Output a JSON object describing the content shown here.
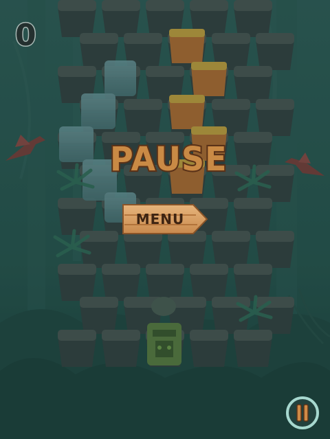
{
  "hud": {
    "score": "0",
    "pause_icon": "pause-icon"
  },
  "pause_menu": {
    "title": "PAUSE",
    "menu_label": "MENU"
  },
  "colors": {
    "overlay": "#1f4a45",
    "stone": "#3a4443",
    "wood_sign": "#d9a46a",
    "title_fill": "#c98a45",
    "title_outline": "#5a3218",
    "pause_ring": "#a7d8cf"
  }
}
